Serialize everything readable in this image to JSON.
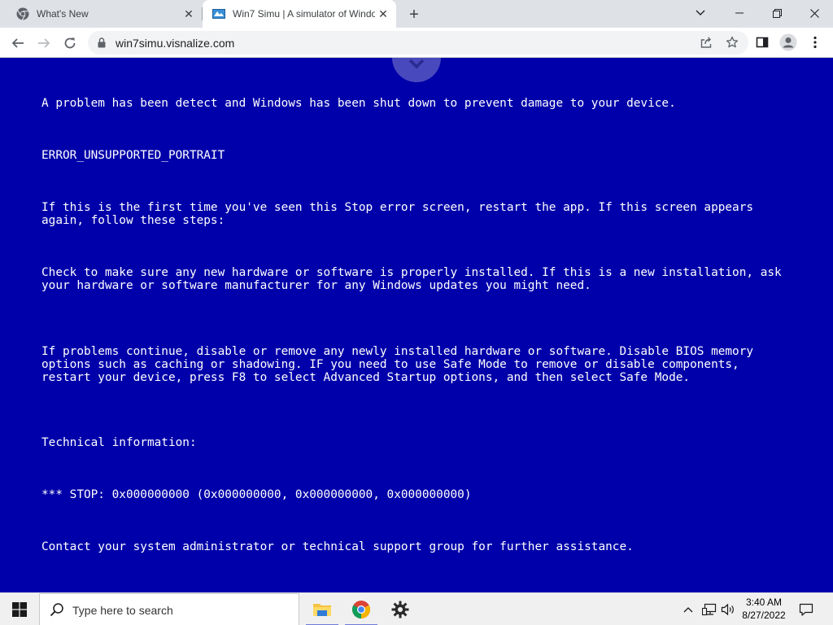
{
  "browser": {
    "tabs": [
      {
        "title": "What's New",
        "active": false
      },
      {
        "title": "Win7 Simu | A simulator of Windo",
        "active": true
      }
    ],
    "url": "win7simu.visnalize.com"
  },
  "bsod": {
    "background_color": "#0000aa",
    "lines": [
      "A problem has been detect and Windows has been shut down to prevent damage to your device.",
      "ERROR_UNSUPPORTED_PORTRAIT",
      "If this is the first time you've seen this Stop error screen, restart the app. If this screen appears again, follow these steps:",
      "Check to make sure any new hardware or software is properly installed. If this is a new installation, ask your hardware or software manufacturer for any Windows updates you might need.",
      "If problems continue, disable or remove any newly installed hardware or software. Disable BIOS memory options such as caching or shadowing. IF you need to use Safe Mode to remove or disable components, restart your device, press F8 to select Advanced Startup options, and then select Safe Mode.",
      "Technical information:",
      "*** STOP: 0x000000000 (0x000000000, 0x000000000, 0x000000000)",
      "Contact your system administrator or technical support group for further assistance."
    ]
  },
  "taskbar": {
    "search_placeholder": "Type here to search",
    "apps": [
      "file-explorer-icon",
      "chrome-icon",
      "settings-icon"
    ],
    "time": "3:40 AM",
    "date": "8/27/2022"
  }
}
